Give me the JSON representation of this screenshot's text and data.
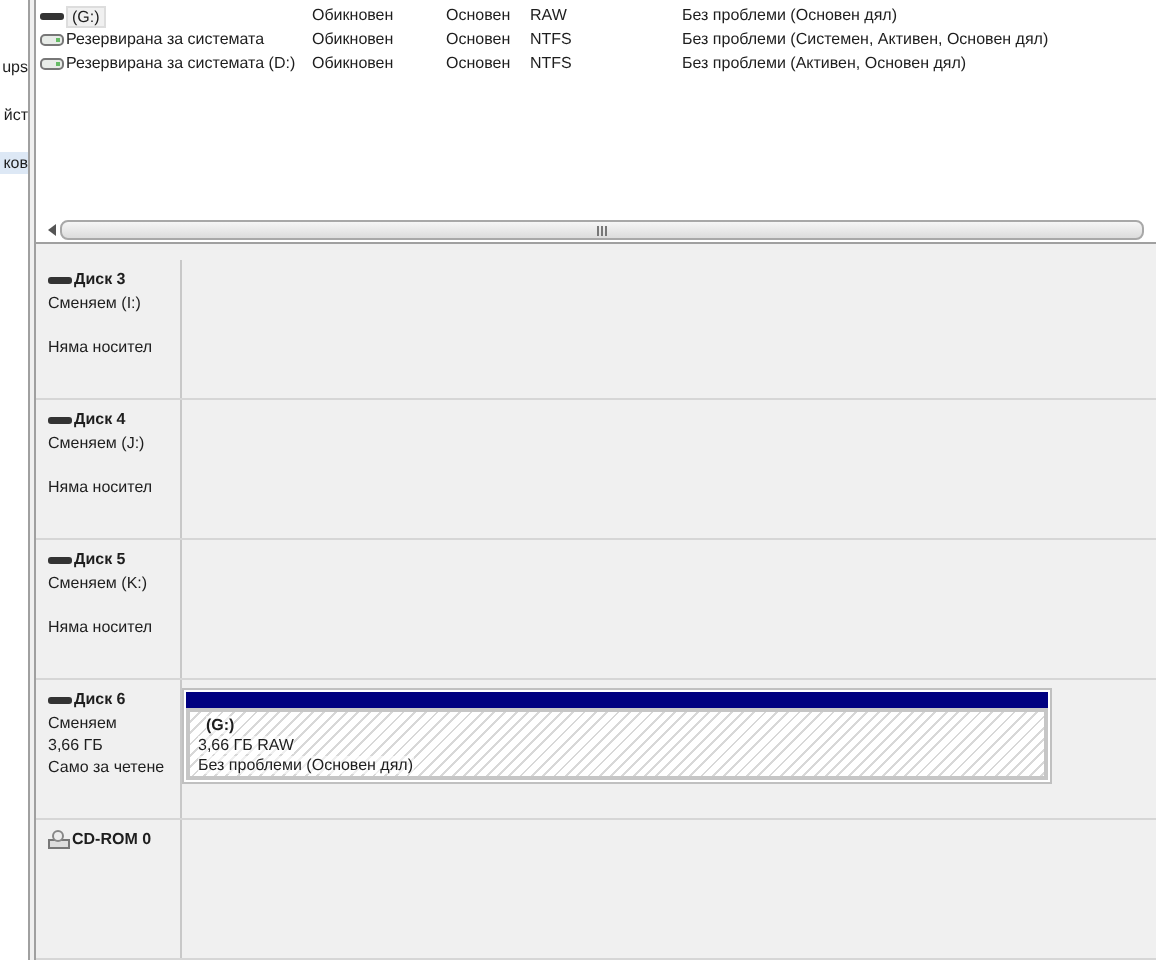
{
  "sidebar": {
    "items": [
      {
        "label": "ups",
        "selected": false
      },
      {
        "label": "йст",
        "selected": false
      },
      {
        "label": "ков",
        "selected": true
      }
    ]
  },
  "volumes": [
    {
      "name": "(G:)",
      "layout": "Обикновен",
      "type": "Основен",
      "file_system": "RAW",
      "status": "Без проблеми (Основен дял)",
      "selected": true
    },
    {
      "name": "Резервирана за системата",
      "layout": "Обикновен",
      "type": "Основен",
      "file_system": "NTFS",
      "status": "Без проблеми (Системен, Активен, Основен дял)",
      "selected": false
    },
    {
      "name": "Резервирана за системата (D:)",
      "layout": "Обикновен",
      "type": "Основен",
      "file_system": "NTFS",
      "status": "Без проблеми (Активен, Основен дял)",
      "selected": false
    }
  ],
  "disks": [
    {
      "kind": "disk",
      "name": "Диск 3",
      "lines": [
        "Сменяем (I:)"
      ],
      "media": "Няма носител"
    },
    {
      "kind": "disk",
      "name": "Диск 4",
      "lines": [
        "Сменяем (J:)"
      ],
      "media": "Няма носител"
    },
    {
      "kind": "disk",
      "name": "Диск 5",
      "lines": [
        "Сменяем (K:)"
      ],
      "media": "Няма носител"
    },
    {
      "kind": "disk",
      "name": "Диск 6",
      "lines": [
        "Сменяем",
        "3,66 ГБ",
        "Само за четене"
      ],
      "partition": {
        "name": "(G:)",
        "size": "3,66 ГБ RAW",
        "status": "Без проблеми (Основен дял)"
      }
    },
    {
      "kind": "cdrom",
      "name": "CD-ROM 0"
    }
  ]
}
